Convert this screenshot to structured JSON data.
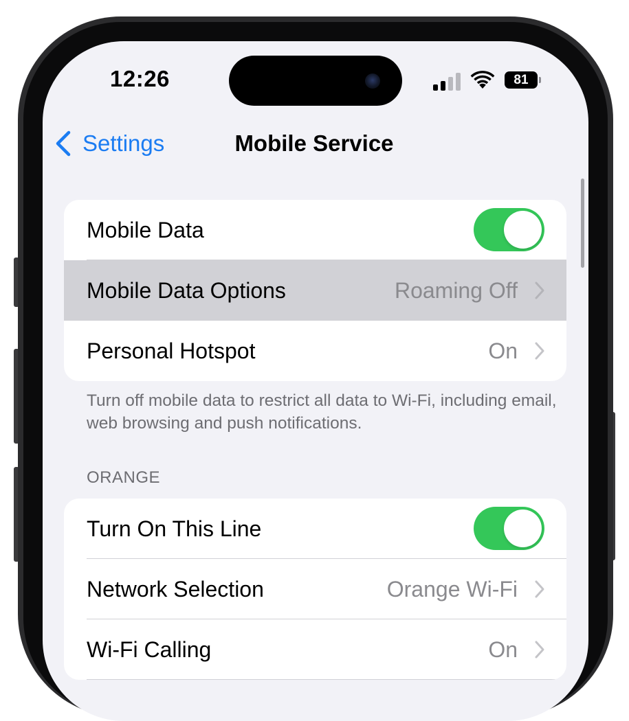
{
  "status_bar": {
    "time": "12:26",
    "battery_percent": "81",
    "signal_bars_active": 2,
    "signal_bars_total": 4
  },
  "nav": {
    "back_label": "Settings",
    "title": "Mobile Service"
  },
  "group1": {
    "rows": [
      {
        "label": "Mobile Data",
        "toggle_on": true
      },
      {
        "label": "Mobile Data Options",
        "value": "Roaming Off",
        "highlighted": true
      },
      {
        "label": "Personal Hotspot",
        "value": "On"
      }
    ],
    "footer": "Turn off mobile data to restrict all data to Wi-Fi, including email, web browsing and push notifications."
  },
  "carrier_section": {
    "header": "ORANGE",
    "rows": [
      {
        "label": "Turn On This Line",
        "toggle_on": true
      },
      {
        "label": "Network Selection",
        "value": "Orange Wi-Fi"
      },
      {
        "label": "Wi-Fi Calling",
        "value": "On"
      }
    ]
  },
  "colors": {
    "accent": "#1b7cf2",
    "toggle_on": "#34c759",
    "secondary_text": "#8a8a8e",
    "background": "#f2f2f7",
    "highlight": "#d1d1d6"
  }
}
